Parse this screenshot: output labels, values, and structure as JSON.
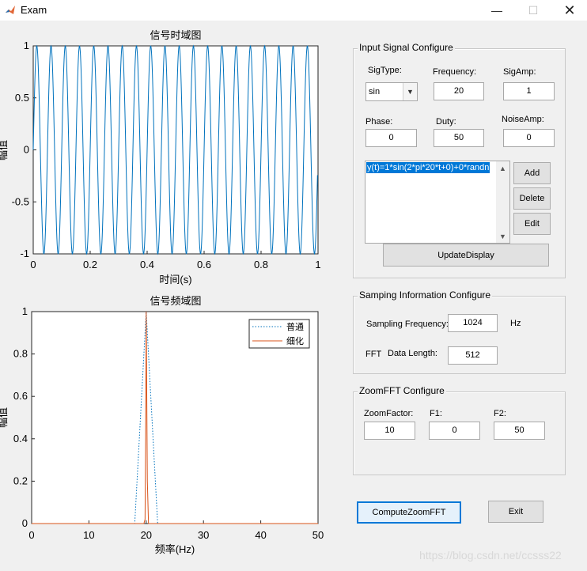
{
  "window": {
    "title": "Exam",
    "minimize": "—",
    "maximize": "☐",
    "close": "✕"
  },
  "colors": {
    "time_signal": "#0072bd",
    "normal_spectrum": "#0072bd",
    "zoom_spectrum": "#d95319"
  },
  "chart_data": [
    {
      "type": "line",
      "title": "信号时域图",
      "xlabel": "时间(s)",
      "ylabel": "幅值",
      "xlim": [
        0,
        1
      ],
      "ylim": [
        -1,
        1
      ],
      "xticks": [
        "0",
        "0.2",
        "0.4",
        "0.6",
        "0.8",
        "1"
      ],
      "yticks": [
        "1",
        "0.5",
        "0",
        "-0.5",
        "-1"
      ],
      "series": [
        {
          "function": "sin(2*pi*20*t)",
          "x_start": 0,
          "x_end": 0.999,
          "sample_rate": 1024,
          "samples": 1024
        }
      ]
    },
    {
      "type": "line",
      "title": "信号频域图",
      "xlabel": "频率(Hz)",
      "ylabel": "幅值",
      "xlim": [
        0,
        50
      ],
      "ylim": [
        0,
        1
      ],
      "xticks": [
        "0",
        "10",
        "20",
        "30",
        "40",
        "50"
      ],
      "yticks": [
        "1",
        "0.8",
        "0.6",
        "0.4",
        "0.2",
        "0"
      ],
      "legend_position": "top-right",
      "series": [
        {
          "name": "普通",
          "style": "dotted",
          "x": [
            0,
            18,
            20,
            22,
            50
          ],
          "y": [
            0,
            0,
            1,
            0,
            0
          ]
        },
        {
          "name": "细化",
          "style": "solid",
          "x": [
            0,
            19.6,
            19.8,
            19.9,
            20.0,
            20.1,
            20.2,
            20.4,
            44,
            50
          ],
          "y": [
            0,
            0,
            0.02,
            0.4,
            1,
            0.6,
            0.2,
            0,
            0,
            0
          ]
        }
      ]
    }
  ],
  "input_panel": {
    "title": "Input Signal Configure",
    "sigtype_label": "SigType:",
    "sigtype_value": "sin",
    "frequency_label": "Frequency:",
    "frequency_value": "20",
    "sigamp_label": "SigAmp:",
    "sigamp_value": "1",
    "phase_label": "Phase:",
    "phase_value": "0",
    "duty_label": "Duty:",
    "duty_value": "50",
    "noiseamp_label": "NoiseAmp:",
    "noiseamp_value": "0",
    "signal_list": [
      "y(t)=1*sin(2*pi*20*t+0)+0*randn"
    ],
    "add_label": "Add",
    "delete_label": "Delete",
    "edit_label": "Edit",
    "update_label": "UpdateDisplay"
  },
  "sampling_panel": {
    "title": "Samping Information Configure",
    "freq_label": "Sampling Frequency:",
    "freq_value": "1024",
    "freq_unit": "Hz",
    "fft_label": "FFT",
    "length_label": "Data Length:",
    "length_value": "512"
  },
  "zoom_panel": {
    "title": "ZoomFFT Configure",
    "factor_label": "ZoomFactor:",
    "factor_value": "10",
    "f1_label": "F1:",
    "f1_value": "0",
    "f2_label": "F2:",
    "f2_value": "50"
  },
  "actions": {
    "compute_label": "ComputeZoomFFT",
    "exit_label": "Exit"
  },
  "watermark": "https://blog.csdn.net/ccsss22"
}
